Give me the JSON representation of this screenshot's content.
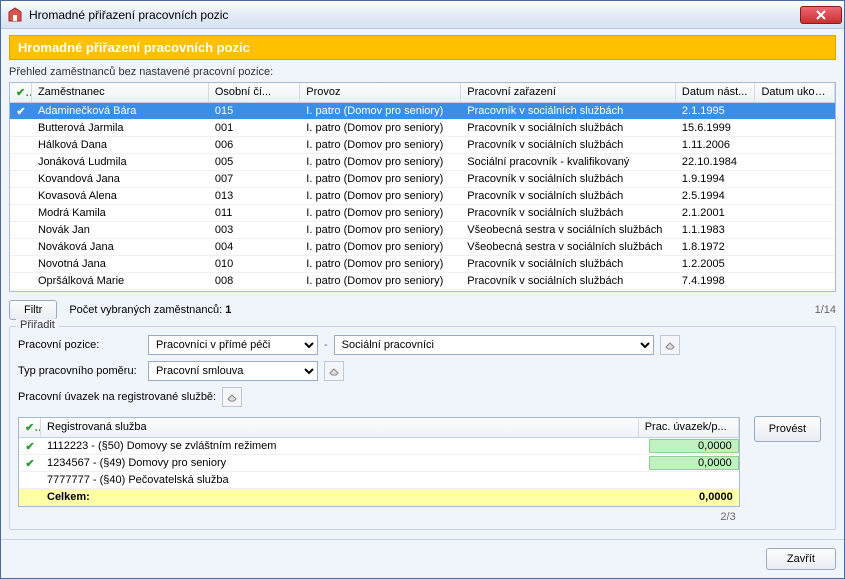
{
  "window": {
    "title": "Hromadné přiřazení pracovních pozic"
  },
  "banner": "Hromadné přiřazení pracovních pozic",
  "employees": {
    "label": "Přehled zaměstnanců bez nastavené pracovní pozice:",
    "headers": {
      "check": "✔",
      "name": "Zaměstnanec",
      "num": "Osobní čí...",
      "loc": "Provoz",
      "role": "Pracovní zařazení",
      "start": "Datum nást...",
      "end": "Datum ukon..."
    },
    "rows": [
      {
        "checked": true,
        "name": "Adaminečková Bára",
        "num": "015",
        "loc": "I. patro (Domov pro seniory)",
        "role": "Pracovník v sociálních službách",
        "start": "2.1.1995",
        "end": "",
        "selected": true
      },
      {
        "checked": false,
        "name": "Butterová Jarmila",
        "num": "001",
        "loc": "I. patro (Domov pro seniory)",
        "role": "Pracovník v sociálních službách",
        "start": "15.6.1999",
        "end": ""
      },
      {
        "checked": false,
        "name": "Hálková Dana",
        "num": "006",
        "loc": "I. patro (Domov pro seniory)",
        "role": "Pracovník v sociálních službách",
        "start": "1.11.2006",
        "end": ""
      },
      {
        "checked": false,
        "name": "Jonáková Ludmila",
        "num": "005",
        "loc": "I. patro (Domov pro seniory)",
        "role": "Sociální pracovník - kvalifikovaný",
        "start": "22.10.1984",
        "end": ""
      },
      {
        "checked": false,
        "name": "Kovandová Jana",
        "num": "007",
        "loc": "I. patro (Domov pro seniory)",
        "role": "Pracovník v sociálních službách",
        "start": "1.9.1994",
        "end": ""
      },
      {
        "checked": false,
        "name": "Kovasová Alena",
        "num": "013",
        "loc": "I. patro (Domov pro seniory)",
        "role": "Pracovník v sociálních službách",
        "start": "2.5.1994",
        "end": ""
      },
      {
        "checked": false,
        "name": "Modrá Kamila",
        "num": "011",
        "loc": "I. patro (Domov pro seniory)",
        "role": "Pracovník v sociálních službách",
        "start": "2.1.2001",
        "end": ""
      },
      {
        "checked": false,
        "name": "Novák Jan",
        "num": "003",
        "loc": "I. patro (Domov pro seniory)",
        "role": "Všeobecná sestra v sociálních službách",
        "start": "1.1.1983",
        "end": ""
      },
      {
        "checked": false,
        "name": "Nováková Jana",
        "num": "004",
        "loc": "I. patro (Domov pro seniory)",
        "role": "Všeobecná sestra v sociálních službách",
        "start": "1.8.1972",
        "end": ""
      },
      {
        "checked": false,
        "name": "Novotná Jana",
        "num": "010",
        "loc": "I. patro (Domov pro seniory)",
        "role": "Pracovník v sociálních službách",
        "start": "1.2.2005",
        "end": ""
      },
      {
        "checked": false,
        "name": "Opršálková Marie",
        "num": "008",
        "loc": "I. patro (Domov pro seniory)",
        "role": "Pracovník v sociálních službách",
        "start": "7.4.1998",
        "end": ""
      }
    ],
    "filter_btn": "Filtr",
    "selected_label": "Počet vybraných zaměstnanců:",
    "selected_count": "1",
    "pager": "1/14"
  },
  "assign": {
    "legend": "Přiřadit",
    "position_label": "Pracovní pozice:",
    "position_value": "Pracovníci v přímé péči",
    "position_sub_value": "Sociální pracovníci",
    "emp_type_label": "Typ pracovního poměru:",
    "emp_type_value": "Pracovní smlouva",
    "registered_label": "Pracovní úvazek na registrované službě:",
    "services": {
      "headers": {
        "check": "✔",
        "name": "Registrovaná služba",
        "val": "Prac. úvazek/p..."
      },
      "rows": [
        {
          "checked": true,
          "name": "1112223 - (§50) Domovy se zvláštním režimem",
          "val": "0,0000",
          "editable": true
        },
        {
          "checked": true,
          "name": "1234567 - (§49) Domovy pro seniory",
          "val": "0,0000",
          "editable": true
        },
        {
          "checked": false,
          "name": "7777777 - (§40) Pečovatelská služba",
          "val": "",
          "editable": false
        }
      ],
      "total_label": "Celkem:",
      "total_value": "0,0000"
    },
    "pager": "2/3",
    "execute_btn": "Provést"
  },
  "footer": {
    "close_btn": "Zavřít"
  }
}
